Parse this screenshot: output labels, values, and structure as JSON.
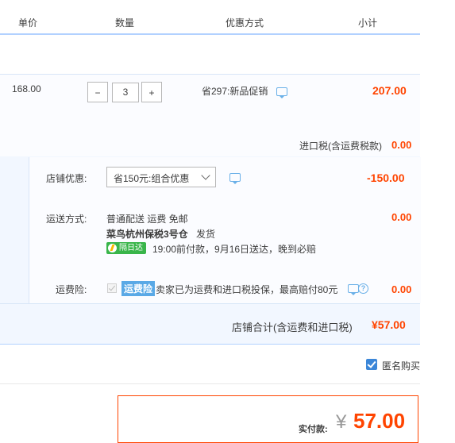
{
  "header": {
    "col_price": "单价",
    "col_qty": "数量",
    "col_promo": "优惠方式",
    "col_subtotal": "小计"
  },
  "item": {
    "price": "168.00",
    "minus": "−",
    "quantity": "3",
    "plus": "+",
    "promo": "省297:新品促销",
    "subtotal": "207.00",
    "import_tax_label": "进口税(含运费税款)",
    "import_tax_value": "0.00"
  },
  "shop": {
    "discount_label": "店铺优惠:",
    "discount_select": "省150元:组合优惠",
    "discount_value": "-150.00",
    "shipping_label": "运送方式:",
    "shipping_line1": "普通配送 运费 免邮",
    "shipping_warehouse": "菜鸟杭州保税3号仓",
    "shipping_dispatch": "发货",
    "next_day_badge": "隔日达",
    "delivery_note": "19:00前付款，9月16日送达，晚到必赔",
    "shipping_value": "0.00",
    "insurance_label": "运费险:",
    "insurance_tag": "运费险",
    "insurance_desc": "卖家已为运费和进口税投保，最高赔付80元",
    "insurance_value": "0.00",
    "help_glyph": "?",
    "total_label": "店铺合计(含运费和进口税)",
    "total_value": "¥57.00"
  },
  "options": {
    "anonymous_label": "匿名购买",
    "anonymous_checked": true
  },
  "payment": {
    "label": "实付款:",
    "currency": "¥",
    "amount": "57.00"
  },
  "colors": {
    "accent_red": "#ff4400",
    "border_blue": "#b2d1ff",
    "checkbox_blue": "#3b86d8",
    "badge_green": "#39b54a"
  },
  "icons": [
    "chat-icon",
    "chevron-down-icon",
    "lightning-icon",
    "help-icon",
    "checkbox-icon"
  ]
}
